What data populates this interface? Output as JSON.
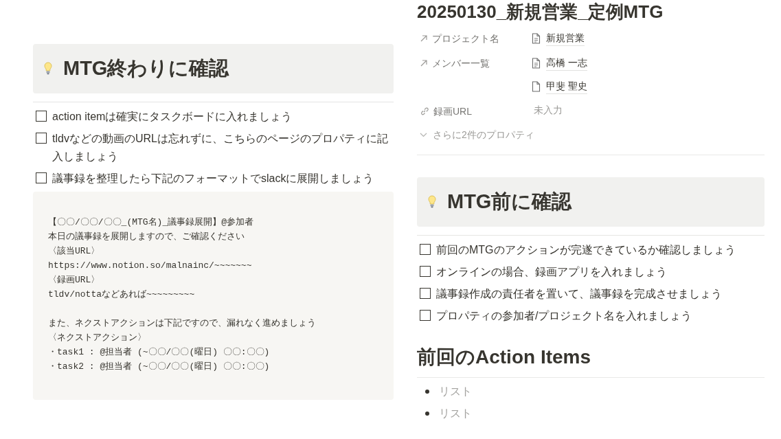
{
  "left": {
    "callout": {
      "title": "MTG終わりに確認"
    },
    "todos": [
      {
        "text": "action itemは確実にタスクボードに入れましょう",
        "checked": false
      },
      {
        "text": "tldvなどの動画のURLは忘れずに、こちらのページのプロパティに記入しましょう",
        "checked": false
      },
      {
        "text": "議事録を整理したら下記のフォーマットでslackに展開しましょう",
        "checked": false
      }
    ],
    "code_block": {
      "paragraphs": [
        [
          "【〇〇/〇〇/〇〇_(MTG名)_議事録展開】@参加者",
          "本日の議事録を展開しますので、ご確認ください",
          "〈該当URL〉",
          "https://www.notion.so/malnainc/~~~~~~~",
          "〈録画URL〉",
          "tldv/nottaなどあれば~~~~~~~~~"
        ],
        [
          "また、ネクストアクションは下記ですので、漏れなく進めましょう",
          "〈ネクストアクション〉",
          "・task1 : @担当者 (~〇〇/〇〇(曜日) 〇〇:〇〇)",
          "・task2 : @担当者 (~〇〇/〇〇(曜日) 〇〇:〇〇)"
        ]
      ]
    }
  },
  "right": {
    "page_title": "20250130_新規営業_定例MTG",
    "properties": [
      {
        "kind": "relation",
        "name": "プロジェクト名",
        "values": [
          "新規営業"
        ]
      },
      {
        "kind": "relation",
        "name": "メンバー一覧",
        "values": [
          "高橋 一志",
          "甲斐 聖史"
        ]
      },
      {
        "kind": "url",
        "name": "録画URL",
        "empty_text": "未入力"
      }
    ],
    "more_properties": "さらに2件のプロパティ",
    "callout": {
      "title": "MTG前に確認"
    },
    "todos": [
      {
        "text": "前回のMTGのアクションが完遂できているか確認しましょう",
        "checked": false
      },
      {
        "text": "オンラインの場合、録画アプリを入れましょう",
        "checked": false
      },
      {
        "text": "議事録作成の責任者を置いて、議事録を完成させましょう",
        "checked": false
      },
      {
        "text": "プロパティの参加者/プロジェクト名を入れましょう",
        "checked": false
      }
    ],
    "heading": "前回のAction Items",
    "bullets": [
      {
        "text": "リスト",
        "placeholder": true
      },
      {
        "text": "リスト",
        "placeholder": true
      }
    ]
  }
}
